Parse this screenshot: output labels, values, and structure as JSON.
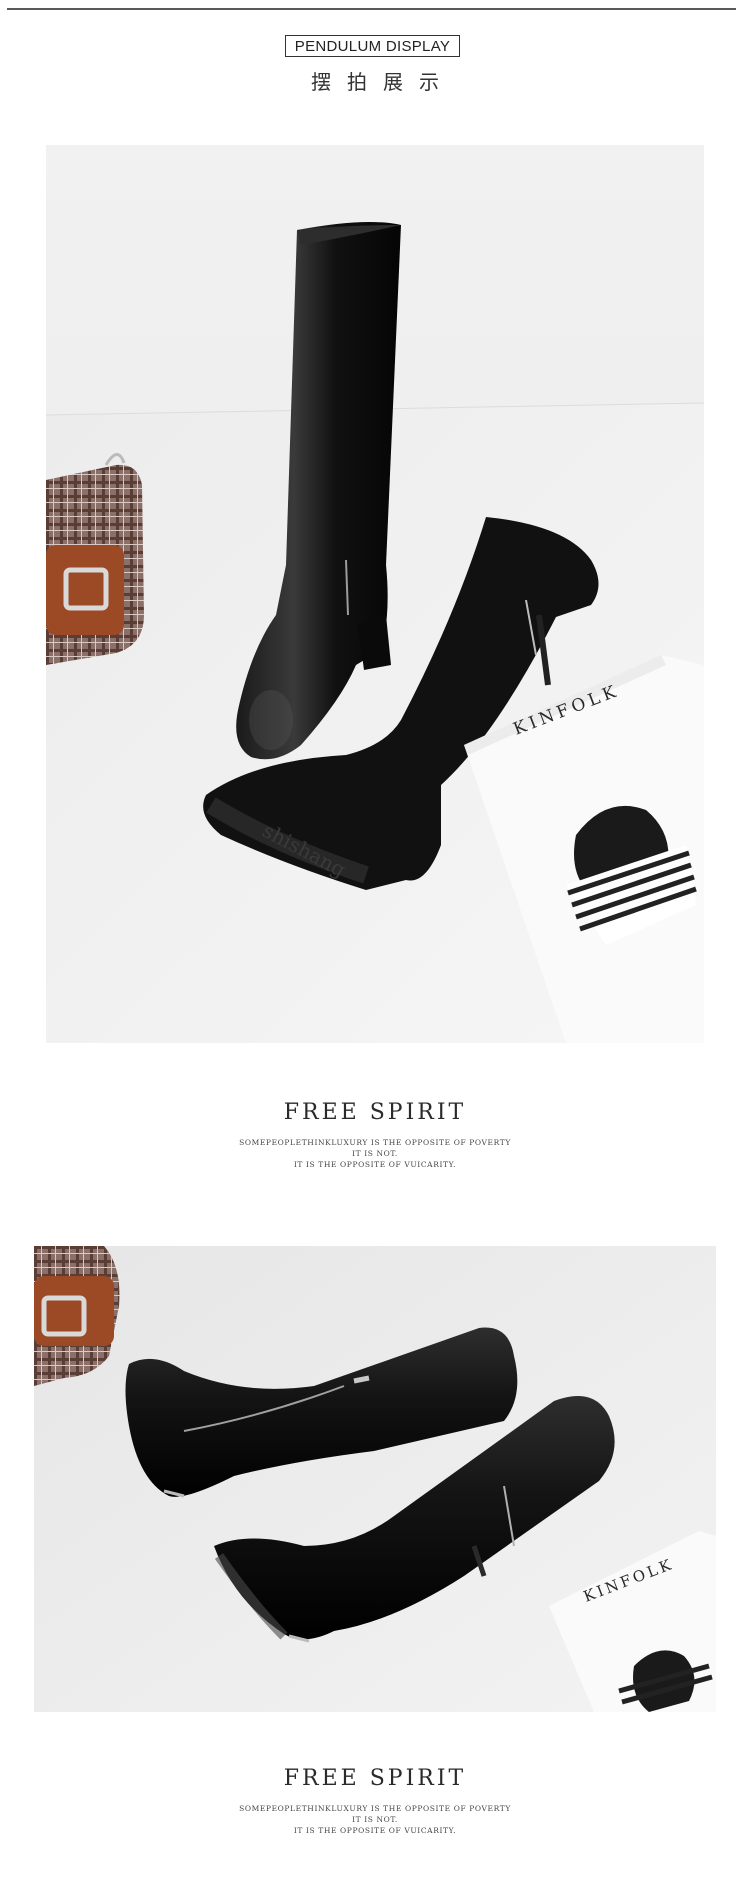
{
  "header": {
    "title_en": "PENDULUM DISPLAY",
    "title_cn": "摆拍展示"
  },
  "photos": [
    {
      "subject": "knee-high boots in leather and suede beside a plaid handbag and a KINFOLK magazine",
      "magazine_label": "KINFOLK",
      "sole_text": "shishang"
    },
    {
      "subject": "pair of black leather knee-high boots lying on side beside a plaid handbag and a KINFOLK magazine",
      "magazine_label": "KINFOLK"
    }
  ],
  "taglines": [
    {
      "heading": "FREE SPIRIT",
      "lines": [
        "SOMEPEOPLETHINKLUXURY IS THE OPPOSITE OF POVERTY",
        "IT IS NOT.",
        "IT IS THE OPPOSITE OF VUICARITY."
      ]
    },
    {
      "heading": "FREE SPIRIT",
      "lines": [
        "SOMEPEOPLETHINKLUXURY IS THE OPPOSITE OF POVERTY",
        "IT IS NOT.",
        "IT IS THE OPPOSITE OF VUICARITY."
      ]
    }
  ],
  "colors": {
    "background": "#ffffff",
    "photo_backdrop": "#eeeeee",
    "leather": "#111111",
    "handbag_tan": "#a0522d"
  }
}
